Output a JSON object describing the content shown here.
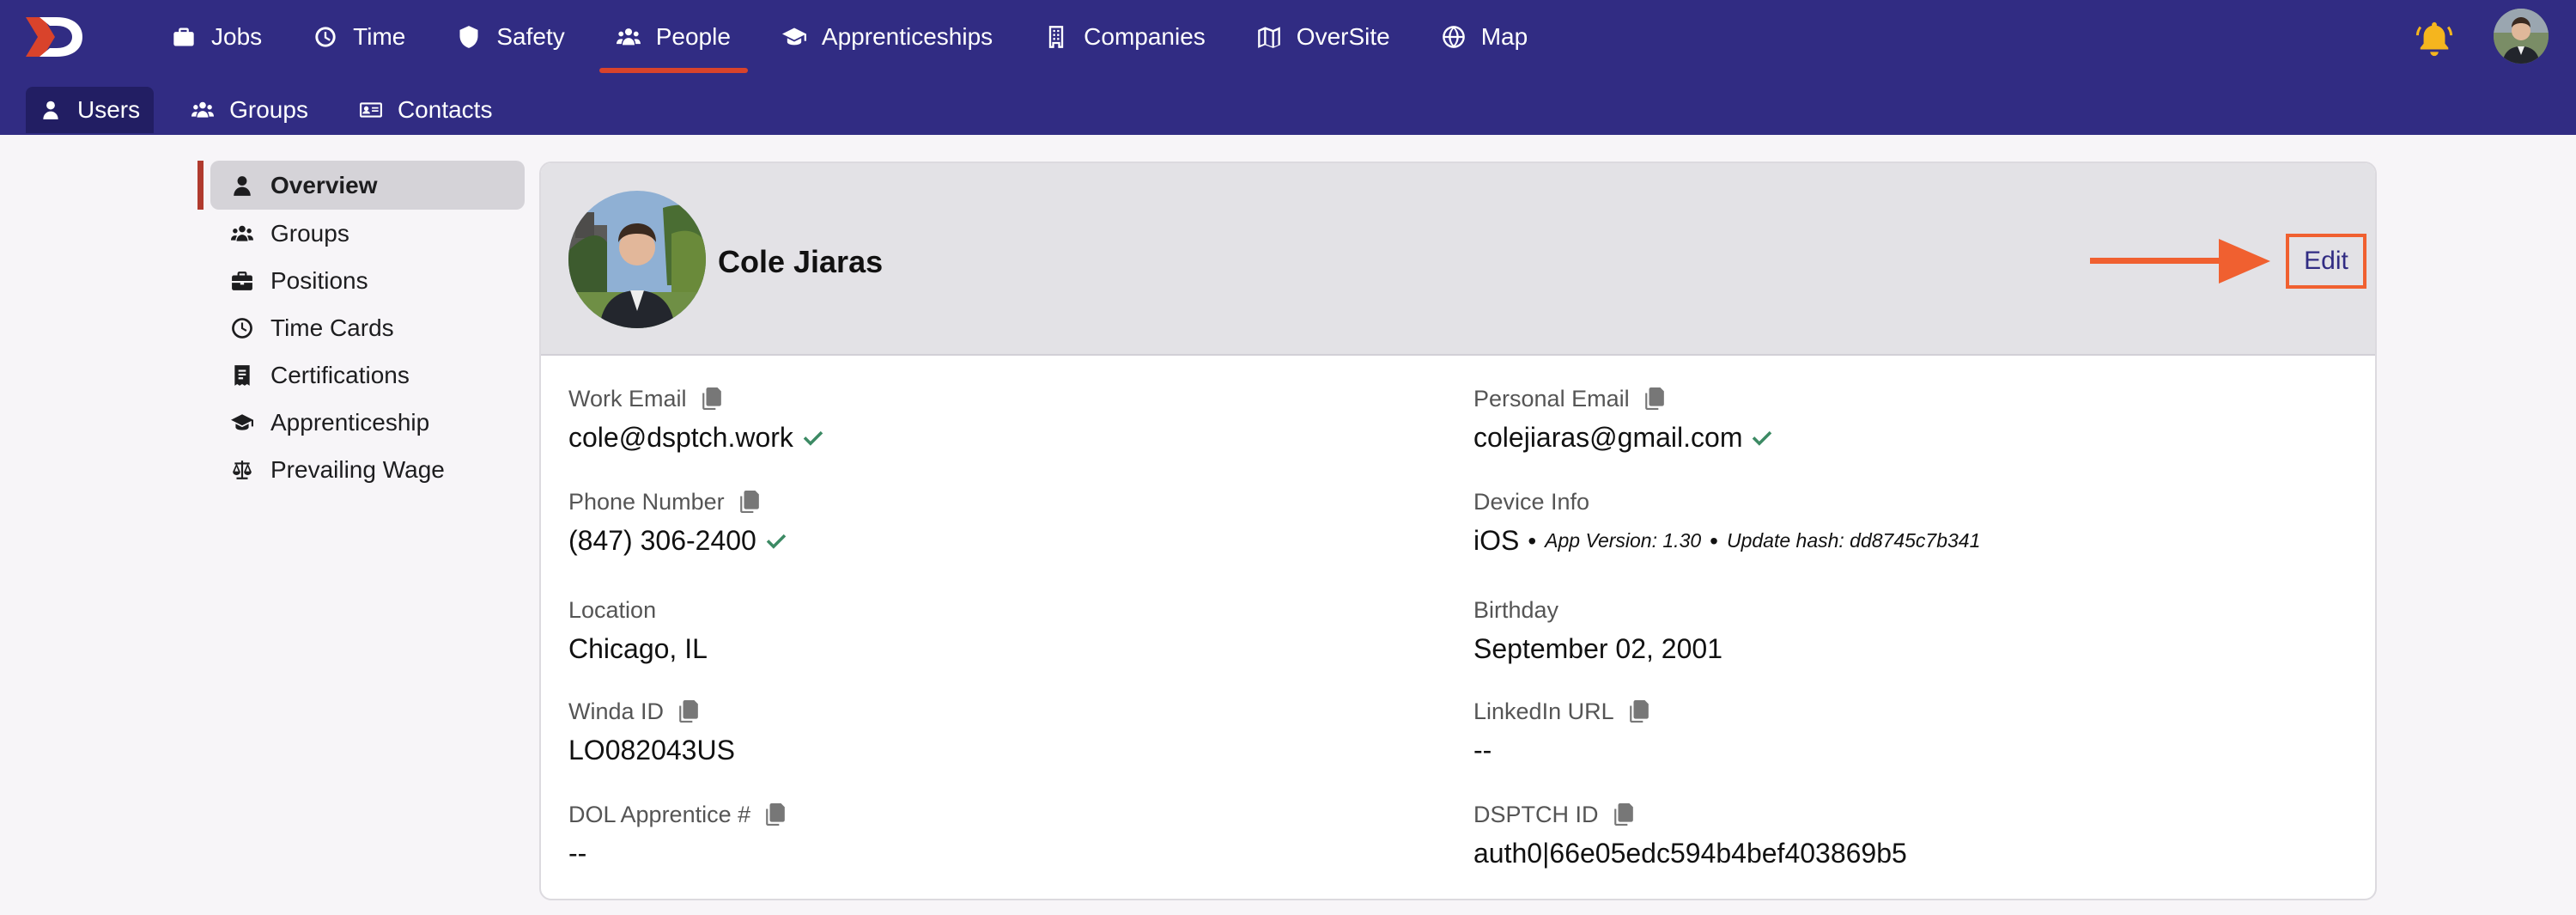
{
  "nav": {
    "items": [
      {
        "label": "Jobs",
        "icon": "briefcase-icon"
      },
      {
        "label": "Time",
        "icon": "clock-icon"
      },
      {
        "label": "Safety",
        "icon": "shield-icon"
      },
      {
        "label": "People",
        "icon": "people-icon",
        "active": true
      },
      {
        "label": "Apprenticeships",
        "icon": "graduation-cap-icon"
      },
      {
        "label": "Companies",
        "icon": "building-icon"
      },
      {
        "label": "OverSite",
        "icon": "map-book-icon"
      },
      {
        "label": "Map",
        "icon": "globe-icon"
      }
    ]
  },
  "subnav": {
    "users": "Users",
    "groups": "Groups",
    "contacts": "Contacts"
  },
  "side": {
    "overview": "Overview",
    "groups": "Groups",
    "positions": "Positions",
    "time_cards": "Time Cards",
    "certifications": "Certifications",
    "apprenticeship": "Apprenticeship",
    "prevailing_wage": "Prevailing Wage"
  },
  "profile": {
    "name": "Cole Jiaras",
    "edit_label": "Edit"
  },
  "fields": {
    "work_email": {
      "label": "Work Email",
      "value": "cole@dsptch.work"
    },
    "personal_email": {
      "label": "Personal Email",
      "value": "colejiaras@gmail.com"
    },
    "phone": {
      "label": "Phone Number",
      "value": "(847) 306-2400"
    },
    "device": {
      "label": "Device Info",
      "os": "iOS",
      "sep": "•",
      "app_version": "App Version: 1.30",
      "update_hash": "Update hash: dd8745c7b341"
    },
    "location": {
      "label": "Location",
      "value": "Chicago, IL"
    },
    "birthday": {
      "label": "Birthday",
      "value": "September 02, 2001"
    },
    "winda": {
      "label": "Winda ID",
      "value": "LO082043US"
    },
    "linkedin": {
      "label": "LinkedIn URL",
      "value": "--"
    },
    "dol": {
      "label": "DOL Apprentice #",
      "value": "--"
    },
    "dsptch": {
      "label": "DSPTCH ID",
      "value": "auth0|66e05edc594b4bef403869b5"
    }
  },
  "colors": {
    "header": "#312c83",
    "active_underline": "#d9432b",
    "verified": "#3c8a64",
    "highlight": "#f06030"
  }
}
